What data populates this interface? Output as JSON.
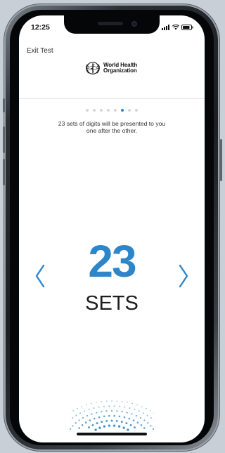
{
  "status_bar": {
    "time": "12:25"
  },
  "header": {
    "exit_label": "Exit Test",
    "logo_line1": "World Health",
    "logo_line2": "Organization"
  },
  "progress": {
    "total_steps": 8,
    "current_step": 6
  },
  "intro": {
    "instruction": "23 sets of digits will be presented to you one after the other.",
    "count": "23",
    "unit": "SETS"
  },
  "colors": {
    "accent": "#2e86c9",
    "text": "#1d1d1d"
  },
  "icons": {
    "prev": "chevron-left-icon",
    "next": "chevron-right-icon",
    "signal": "signal-icon",
    "wifi": "wifi-icon",
    "battery": "battery-icon",
    "logo": "who-emblem-icon"
  }
}
